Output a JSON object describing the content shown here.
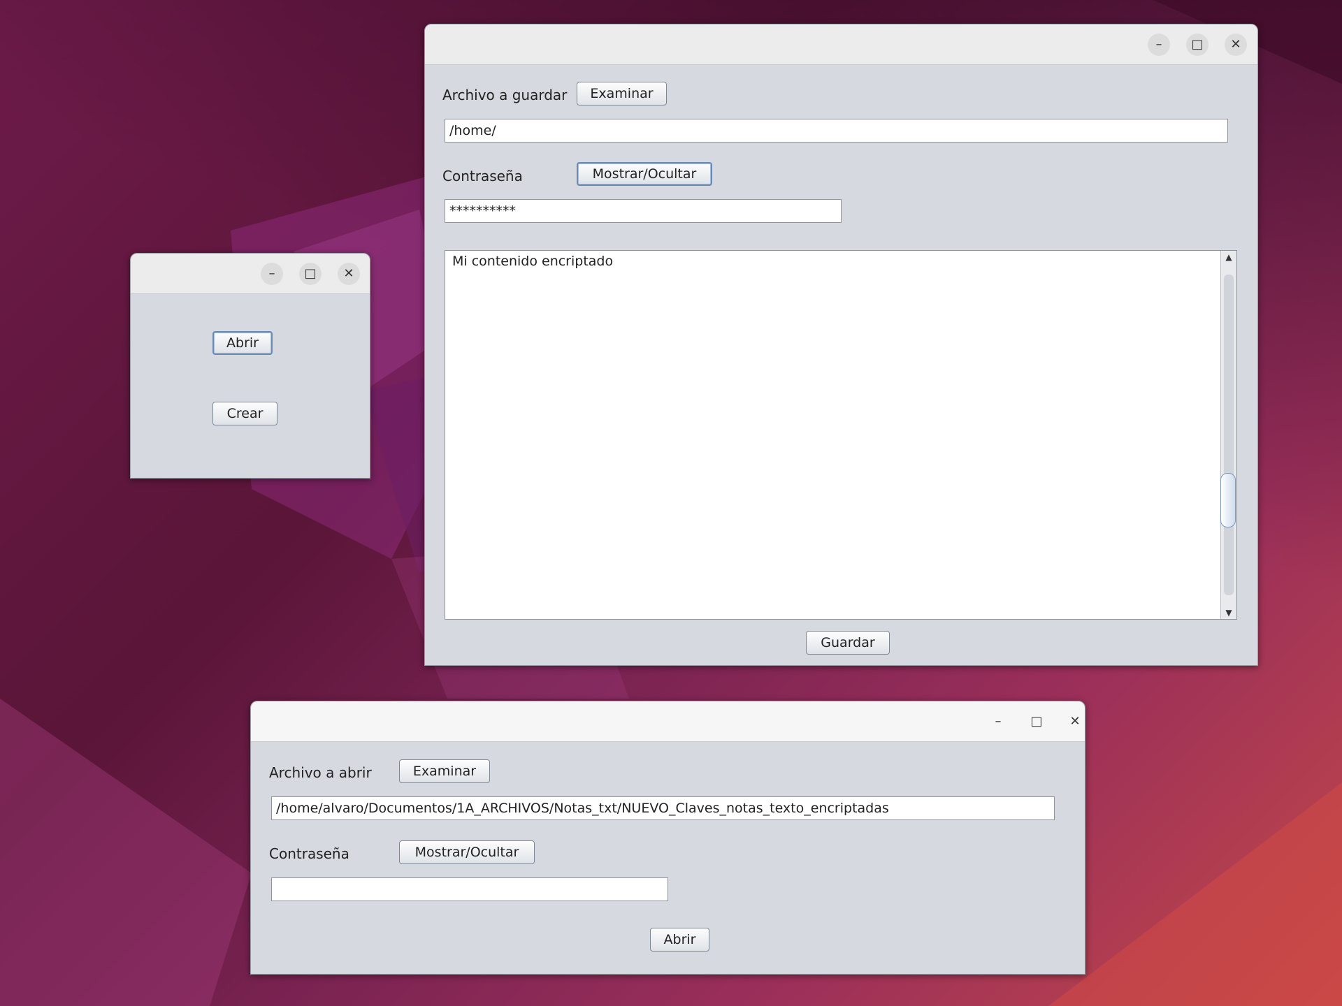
{
  "windows": {
    "launcher": {
      "open_button": "Abrir",
      "create_button": "Crear"
    },
    "save": {
      "file_label": "Archivo a guardar",
      "browse_button": "Examinar",
      "path_value": "/home/",
      "password_label": "Contraseña",
      "toggle_button": "Mostrar/Ocultar",
      "password_value": "**********",
      "content": "Mi contenido encriptado",
      "save_button": "Guardar"
    },
    "open": {
      "file_label": "Archivo a abrir",
      "browse_button": "Examinar",
      "path_value": "/home/alvaro/Documentos/1A_ARCHIVOS/Notas_txt/NUEVO_Claves_notas_texto_encriptadas",
      "password_label": "Contraseña",
      "toggle_button": "Mostrar/Ocultar",
      "password_value": "",
      "open_button": "Abrir"
    }
  },
  "icons": {
    "minimize": "minimize-icon",
    "maximize": "maximize-icon",
    "close": "close-icon",
    "scroll_up": "arrow-up-icon",
    "scroll_down": "arrow-down-icon"
  },
  "colors": {
    "window_bg": "#d6d9df",
    "titlebar_bg": "#ececec",
    "field_bg": "#ffffff"
  }
}
